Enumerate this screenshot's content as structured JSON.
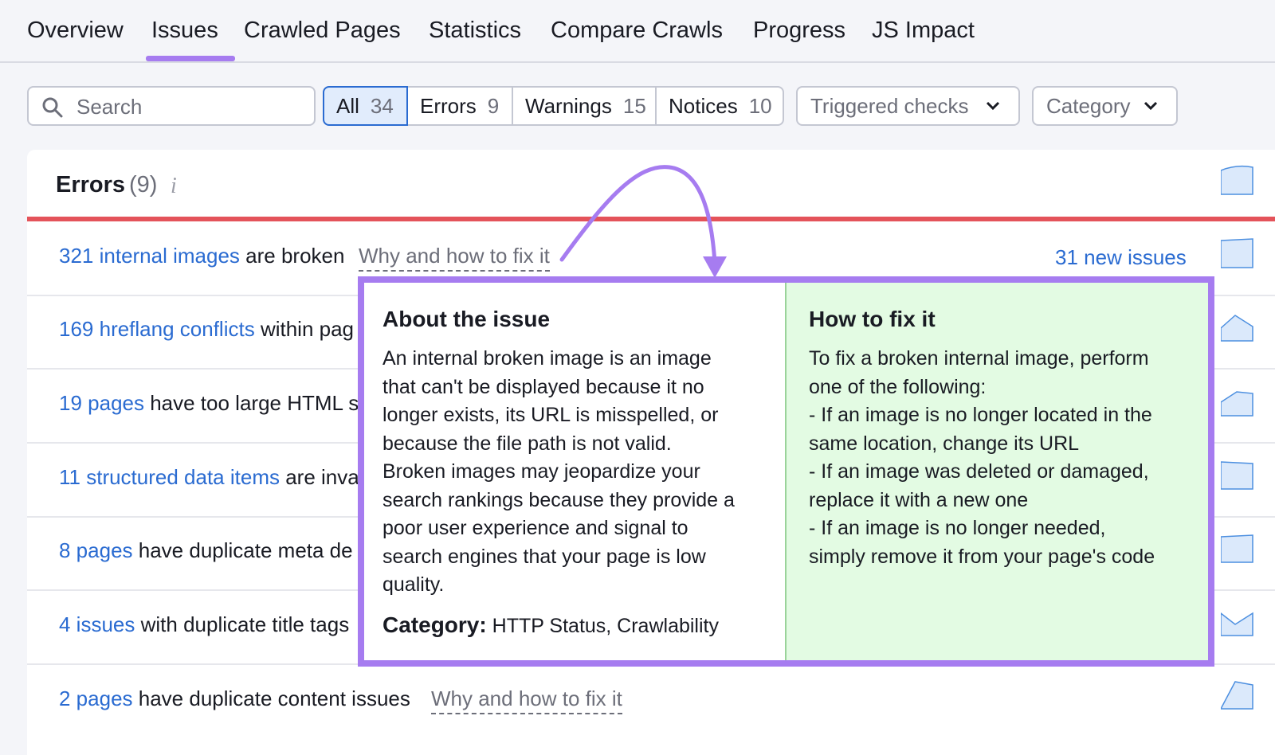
{
  "tabs": [
    "Overview",
    "Issues",
    "Crawled Pages",
    "Statistics",
    "Compare Crawls",
    "Progress",
    "JS Impact"
  ],
  "active_tab": "Issues",
  "search": {
    "placeholder": "Search"
  },
  "filters": [
    {
      "label": "All",
      "count": "34",
      "active": true
    },
    {
      "label": "Errors",
      "count": "9",
      "active": false
    },
    {
      "label": "Warnings",
      "count": "15",
      "active": false
    },
    {
      "label": "Notices",
      "count": "10",
      "active": false
    }
  ],
  "dropdowns": {
    "triggered": "Triggered checks",
    "category": "Category"
  },
  "section": {
    "title": "Errors",
    "count": "(9)",
    "info": "i"
  },
  "rows": [
    {
      "link": "321 internal images",
      "text": " are broken",
      "why": "Why and how to fix it",
      "new": "31 new issues"
    },
    {
      "link": "169 hreflang conflicts",
      "text": " within pag"
    },
    {
      "link": "19 pages",
      "text": " have too large HTML s"
    },
    {
      "link": "11 structured data items",
      "text": " are inva"
    },
    {
      "link": "8 pages",
      "text": " have duplicate meta de"
    },
    {
      "link": "4 issues",
      "text": " with duplicate title tags"
    },
    {
      "link": "2 pages",
      "text": " have duplicate content issues",
      "why": "Why and how to fix it"
    }
  ],
  "popup": {
    "about_title": "About the issue",
    "about_lines": [
      "An internal broken image is an image",
      "that can't be displayed because it no",
      "longer exists, its URL is misspelled, or",
      "because the file path is not valid.",
      "Broken images may jeopardize your",
      "search rankings because they provide a",
      "poor user experience and signal to",
      "search engines that your page is low",
      "quality."
    ],
    "category_label": "Category:",
    "category_value": " HTTP Status, Crawlability",
    "fix_title": "How to fix it",
    "fix_lines": [
      "To fix a broken internal image, perform",
      "one of the following:",
      "- If an image is no longer located in the",
      "same location, change its URL",
      "- If an image was deleted or damaged,",
      "replace it with a new one",
      "- If an image is no longer needed,",
      "simply remove it from your page's code"
    ]
  },
  "colors": {
    "accent": "#a67cf0",
    "link": "#2a6bd1",
    "error": "#e4535a",
    "fix_bg": "#e3fbe3"
  },
  "icons": [
    "search-icon",
    "chevron-down-icon",
    "info-icon",
    "arrow-annotation"
  ]
}
